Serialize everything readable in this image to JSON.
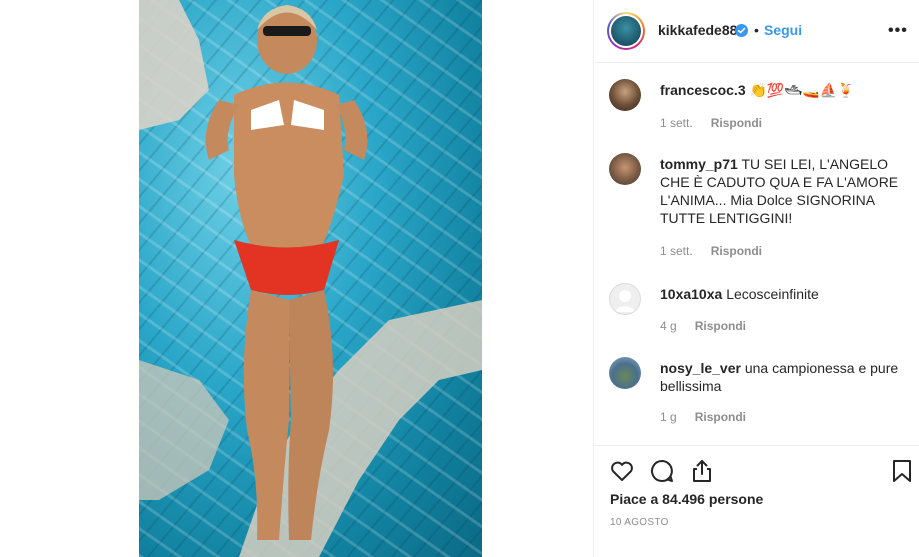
{
  "post": {
    "username": "kikkafede88",
    "follow_label": "Segui",
    "separator": "•",
    "more_label": "•••",
    "likes_text": "Piace a 84.496 persone",
    "date": "10 AGOSTO"
  },
  "comments": [
    {
      "user": "francescoc.3",
      "text": "👏💯🛥🚤⛵🍹",
      "time": "1 sett.",
      "reply": "Rispondi"
    },
    {
      "user": "tommy_p71",
      "text": "TU SEI LEI, L'ANGELO CHE È CADUTO QUA E FA L'AMORE L'ANIMA... Mia Dolce SIGNORINA TUTTE LENTIGGINI!",
      "time": "1 sett.",
      "reply": "Rispondi"
    },
    {
      "user": "10xa10xa",
      "text": "Lecosceinfinite",
      "time": "4 g",
      "reply": "Rispondi"
    },
    {
      "user": "nosy_le_ver",
      "text": "una campionessa e pure bellissima",
      "time": "1 g",
      "reply": "Rispondi"
    }
  ],
  "icons": {
    "like": "heart-icon",
    "comment": "comment-icon",
    "share": "share-icon",
    "save": "bookmark-icon",
    "verified": "verified-badge-icon"
  },
  "colors": {
    "link": "#3897f0",
    "text": "#262626",
    "muted": "#8e8e8e"
  }
}
